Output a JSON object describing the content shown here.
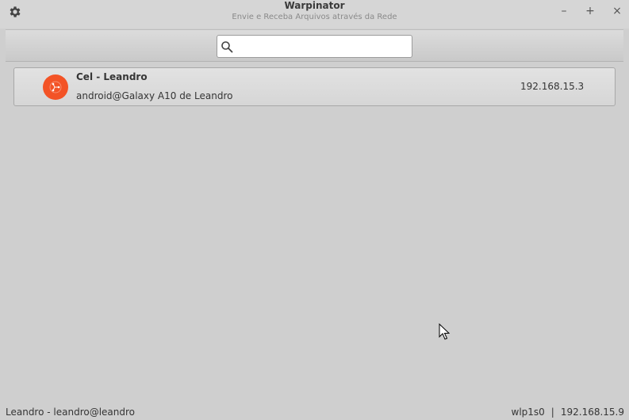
{
  "window": {
    "title": "Warpinator",
    "subtitle": "Envie e Receba Arquivos através da Rede",
    "minimize_glyph": "–",
    "maximize_glyph": "+",
    "close_glyph": "×"
  },
  "icons": {
    "menu": "gear-icon",
    "search": "search-icon",
    "device": "warpinator-share-icon",
    "accent": "#f35326"
  },
  "search": {
    "value": "",
    "placeholder": ""
  },
  "devices": [
    {
      "name": "Cel - Leandro",
      "user": "android@Galaxy A10 de Leandro",
      "ip": "192.168.15.3"
    }
  ],
  "status": {
    "user": "Leandro - leandro@leandro",
    "interface": "wlp1s0",
    "separator": "|",
    "ip": "192.168.15.9"
  }
}
